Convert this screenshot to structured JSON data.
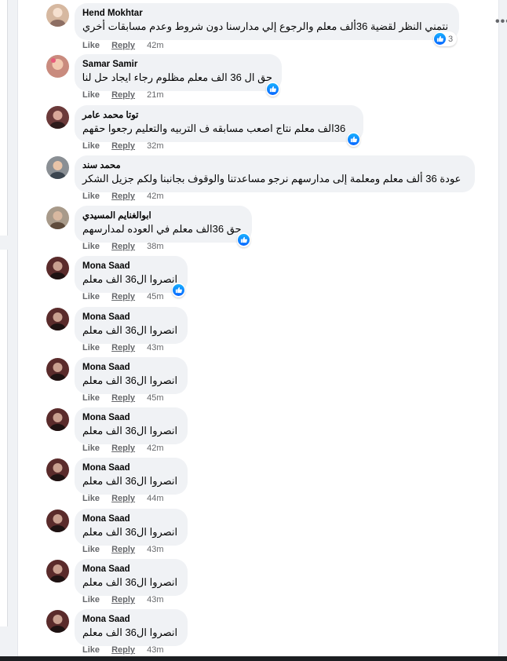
{
  "actions": {
    "like": "Like",
    "reply": "Reply"
  },
  "comments": [
    {
      "author": "Hend Mokhtar",
      "text": "نتمني النظر لقضية 36ألف معلم والرجوع إلي مدارسنا دون شروط وعدم مسابقات أخري",
      "time": "42m",
      "reaction_count": "3",
      "avatar_color": "#d6b8a0"
    },
    {
      "author": "Samar Samir",
      "text": "حق ال 36 الف معلم مظلوم رجاء ايجاد حل لنا",
      "time": "21m",
      "avatar_color": "#c98b7e"
    },
    {
      "author": "توتا محمد عامر",
      "text": "36الف معلم نتاج اصعب مسابقه ف التربيه والتعليم رجعوا حقهم",
      "time": "32m",
      "avatar_color": "#6b3a3a"
    },
    {
      "author": "محمد سند",
      "text": "عودة 36 ألف معلم ومعلمة إلى مدارسهم نرجو مساعدتنا والوقوف بجانبنا ولكم جزيل الشكر",
      "time": "42m",
      "avatar_color": "#8a8f94"
    },
    {
      "author": "ابوالغنايم المسيدي",
      "text": "حق 36الف معلم في العوده لمدارسهم",
      "time": "38m",
      "avatar_color": "#a89a8a"
    },
    {
      "author": "Mona Saad",
      "text": "انصروا ال36 الف معلم",
      "time": "45m",
      "avatar_color": "#5a2b2b"
    },
    {
      "author": "Mona Saad",
      "text": "انصروا ال36 الف معلم",
      "time": "43m",
      "avatar_color": "#5a2b2b"
    },
    {
      "author": "Mona Saad",
      "text": "انصروا ال36 الف معلم",
      "time": "45m",
      "avatar_color": "#5a2b2b"
    },
    {
      "author": "Mona Saad",
      "text": "انصروا ال36 الف معلم",
      "time": "42m",
      "avatar_color": "#5a2b2b"
    },
    {
      "author": "Mona Saad",
      "text": "انصروا ال36 الف معلم",
      "time": "44m",
      "avatar_color": "#5a2b2b"
    },
    {
      "author": "Mona Saad",
      "text": "انصروا ال36 الف معلم",
      "time": "43m",
      "avatar_color": "#5a2b2b"
    },
    {
      "author": "Mona Saad",
      "text": "انصروا ال36 الف معلم",
      "time": "43m",
      "avatar_color": "#5a2b2b"
    },
    {
      "author": "Mona Saad",
      "text": "انصروا ال36 الف معلم",
      "time": "43m",
      "avatar_color": "#5a2b2b"
    }
  ],
  "more_label": "•••"
}
